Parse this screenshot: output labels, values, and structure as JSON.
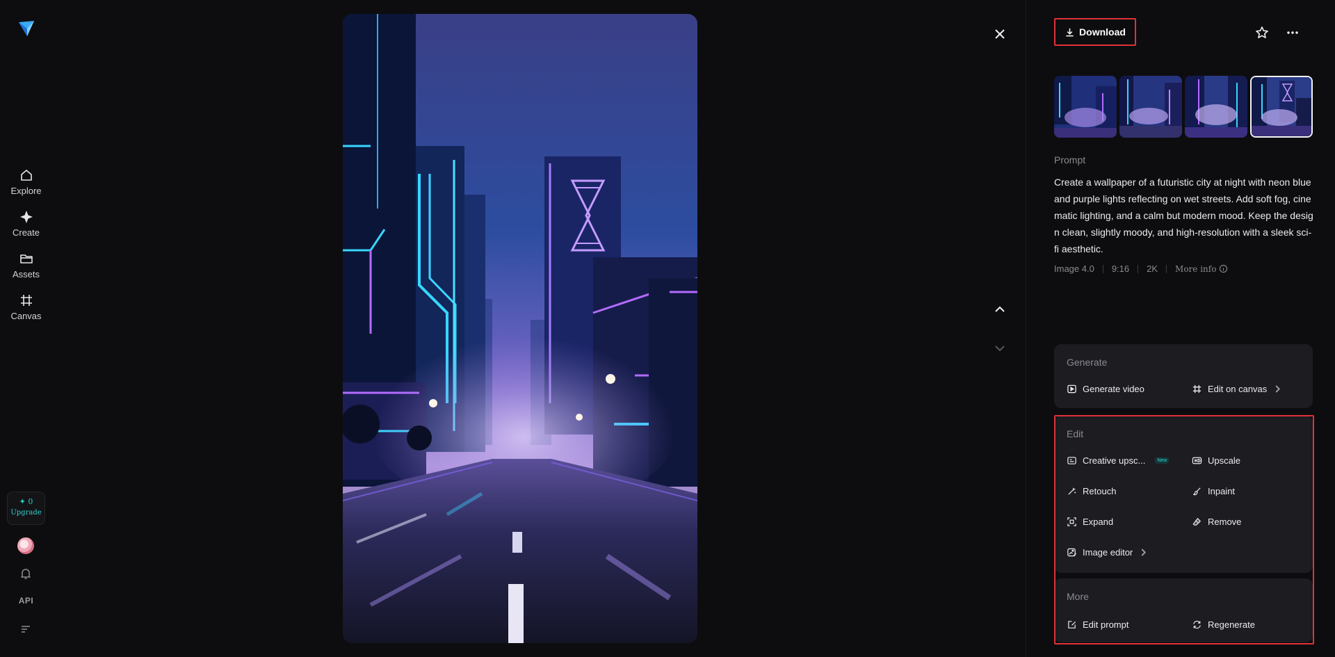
{
  "sidebar": {
    "items": [
      {
        "label": "Explore",
        "icon": "home-icon"
      },
      {
        "label": "Create",
        "icon": "sparkle-icon"
      },
      {
        "label": "Assets",
        "icon": "folder-icon"
      },
      {
        "label": "Canvas",
        "icon": "canvas-icon"
      }
    ],
    "credits": "✦ 0",
    "upgrade_label": "Upgrade",
    "api_label": "API"
  },
  "toolbar": {
    "download_label": "Download"
  },
  "prompt": {
    "title": "Prompt",
    "text": "Create a wallpaper of a futuristic city at night with neon blue and purple lights reflecting on wet streets. Add soft fog, cinematic lighting, and a calm but modern mood. Keep the design clean, slightly moody, and high-resolution with a sleek sci-fi aesthetic."
  },
  "meta": {
    "model": "Image 4.0",
    "ratio": "9:16",
    "resolution": "2K",
    "more_info": "More info"
  },
  "generate": {
    "title": "Generate",
    "actions": [
      {
        "label": "Generate video",
        "icon": "play-video-icon"
      },
      {
        "label": "Edit on canvas",
        "icon": "canvas-icon"
      }
    ]
  },
  "edit": {
    "title": "Edit",
    "new_badge": "New",
    "actions": [
      {
        "label": "Creative upsc...",
        "icon": "creative-upscale-icon"
      },
      {
        "label": "Upscale",
        "icon": "hd-icon"
      },
      {
        "label": "Retouch",
        "icon": "magic-wand-icon"
      },
      {
        "label": "Inpaint",
        "icon": "brush-icon"
      },
      {
        "label": "Expand",
        "icon": "expand-icon"
      },
      {
        "label": "Remove",
        "icon": "eraser-icon"
      },
      {
        "label": "Image editor",
        "icon": "image-edit-icon"
      }
    ]
  },
  "more": {
    "title": "More",
    "actions": [
      {
        "label": "Edit prompt",
        "icon": "edit-note-icon"
      },
      {
        "label": "Regenerate",
        "icon": "regenerate-icon"
      }
    ]
  },
  "colors": {
    "background": "#0d0d0f",
    "card": "#1c1c21",
    "highlight_border": "#e03238",
    "accent": "#2fd0c8"
  }
}
